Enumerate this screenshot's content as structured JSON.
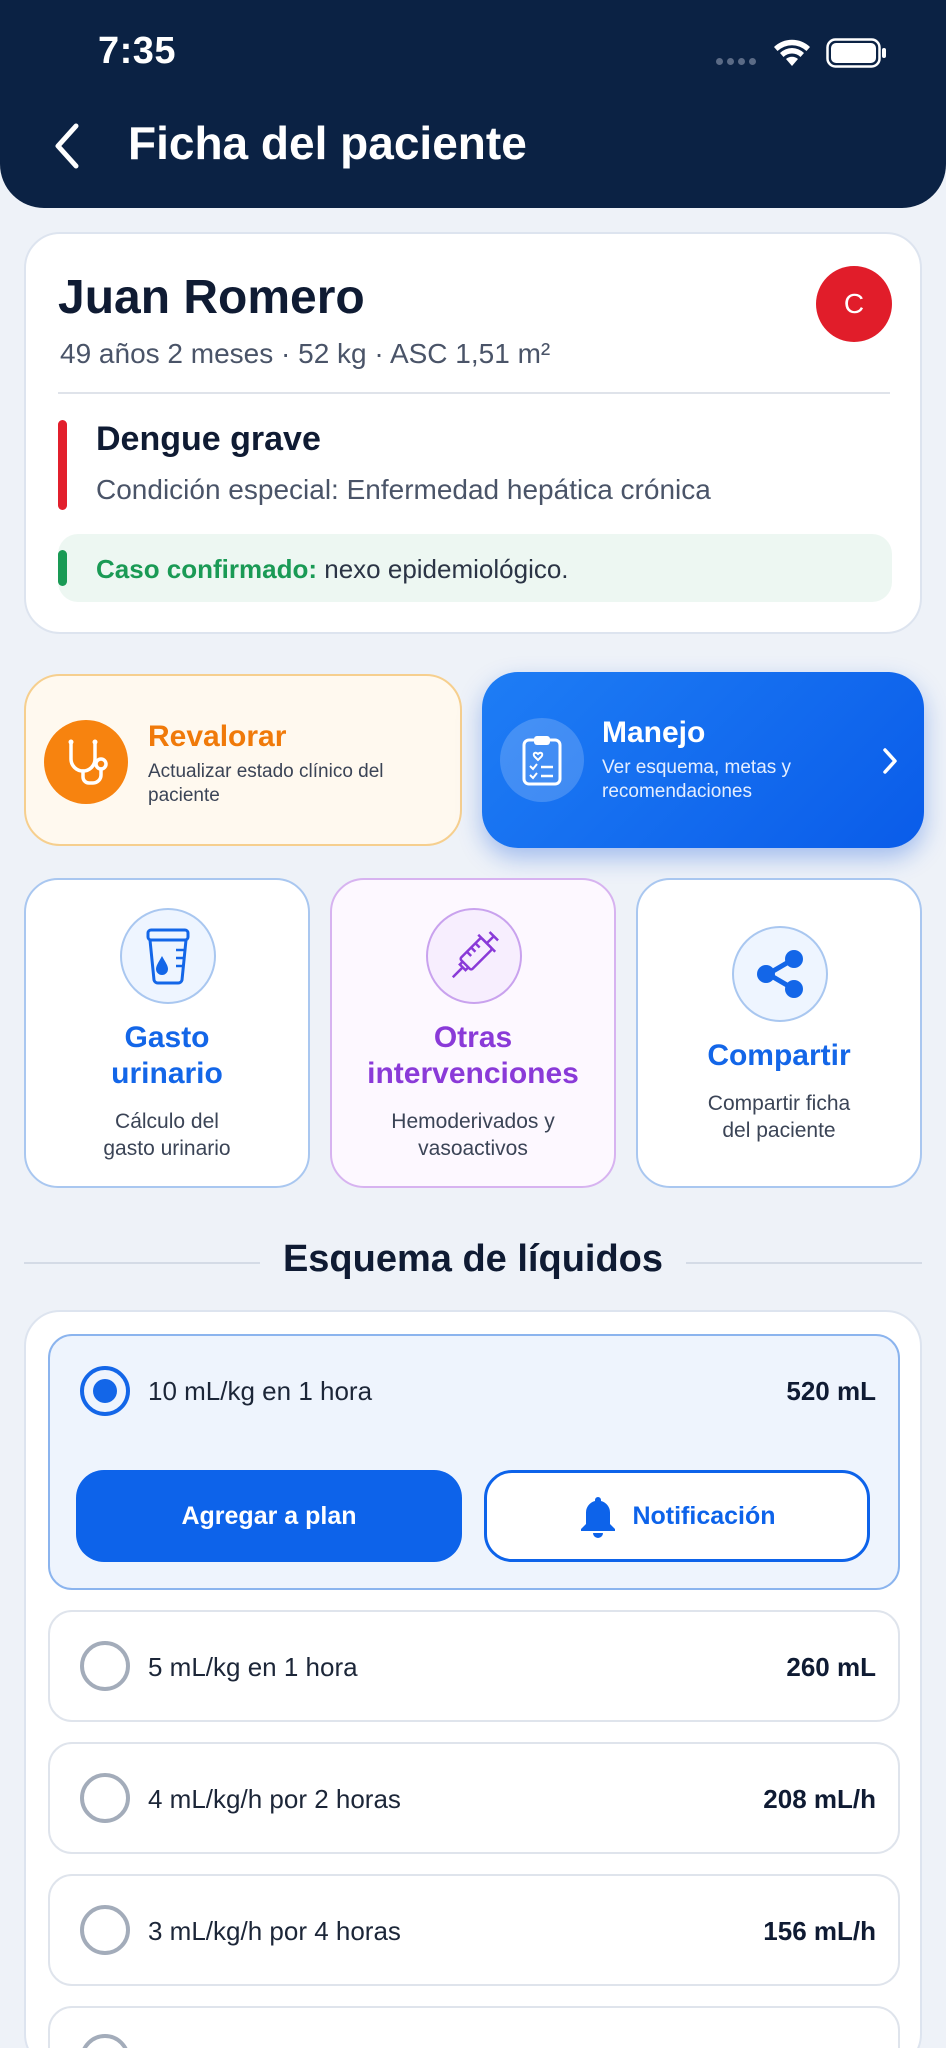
{
  "status_bar": {
    "time": "7:35"
  },
  "header": {
    "title": "Ficha del paciente"
  },
  "patient": {
    "name": "Juan Romero",
    "meta": "49 años 2 meses · 52 kg · ASC 1,51 m²",
    "avatar_letter": "C",
    "diagnosis": "Dengue grave",
    "special_condition": "Condición especial: Enfermedad hepática crónica",
    "confirm_label": "Caso confirmado:",
    "confirm_detail": " nexo epidemiológico."
  },
  "actions": {
    "revalorar": {
      "title": "Revalorar",
      "subtitle": "Actualizar estado clínico del paciente"
    },
    "manejo": {
      "title": "Manejo",
      "subtitle": "Ver esquema, metas y recomendaciones"
    }
  },
  "tools": [
    {
      "title_line1": "Gasto",
      "title_line2": "urinario",
      "sub_line1": "Cálculo del",
      "sub_line2": "gasto urinario"
    },
    {
      "title_line1": "Otras",
      "title_line2": "intervenciones",
      "sub_line1": "Hemoderivados y",
      "sub_line2": "vasoactivos"
    },
    {
      "title": "Compartir",
      "sub_line1": "Compartir ficha",
      "sub_line2": "del paciente"
    }
  ],
  "fluids": {
    "section_title": "Esquema de líquidos",
    "items": [
      {
        "label": "10 mL/kg en 1 hora",
        "value": "520 mL",
        "selected": true
      },
      {
        "label": "5 mL/kg en 1 hora",
        "value": "260 mL",
        "selected": false
      },
      {
        "label": "4 mL/kg/h por 2 horas",
        "value": "208 mL/h",
        "selected": false
      },
      {
        "label": "3 mL/kg/h por 4 horas",
        "value": "156 mL/h",
        "selected": false
      }
    ],
    "add_button": "Agregar a plan",
    "notify_button": "Notificación"
  },
  "colors": {
    "header_bg": "#0b2244",
    "primary": "#0d63ea",
    "danger": "#e21f2c",
    "success": "#1a9a55",
    "orange": "#f7830f",
    "purple": "#8a3ad8"
  }
}
